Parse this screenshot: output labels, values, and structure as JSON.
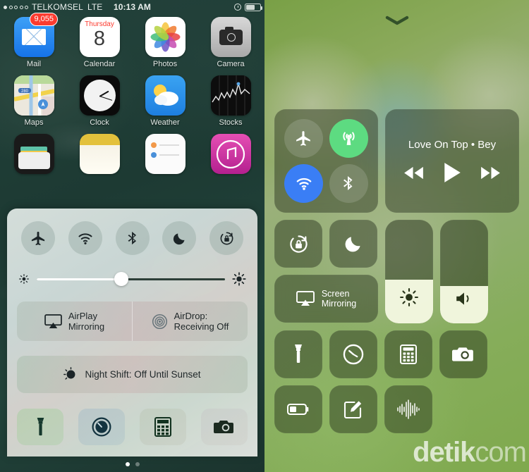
{
  "statusbar": {
    "carrier": "TELKOMSEL",
    "network": "LTE",
    "time": "10:13 AM",
    "signal_dots_total": 5,
    "signal_dots_filled": 1,
    "alarm_icon": "alarm-clock-icon",
    "battery_icon": "battery-icon",
    "battery_level_pct": 62
  },
  "homescreen": {
    "rows": [
      [
        {
          "label": "Mail",
          "icon": "mail-icon",
          "badge": "9,055"
        },
        {
          "label": "Calendar",
          "icon": "calendar-icon",
          "weekday": "Thursday",
          "day": "8"
        },
        {
          "label": "Photos",
          "icon": "photos-icon"
        },
        {
          "label": "Camera",
          "icon": "camera-icon"
        }
      ],
      [
        {
          "label": "Maps",
          "icon": "maps-icon",
          "route_badge": "280"
        },
        {
          "label": "Clock",
          "icon": "clock-icon"
        },
        {
          "label": "Weather",
          "icon": "weather-icon"
        },
        {
          "label": "Stocks",
          "icon": "stocks-icon"
        }
      ]
    ]
  },
  "control_center_ios10": {
    "toggles": [
      {
        "name": "airplane-mode",
        "icon": "airplane-icon",
        "active": false
      },
      {
        "name": "wifi",
        "icon": "wifi-icon",
        "active": false
      },
      {
        "name": "bluetooth",
        "icon": "bluetooth-icon",
        "active": false
      },
      {
        "name": "do-not-disturb",
        "icon": "moon-icon",
        "active": false
      },
      {
        "name": "rotation-lock",
        "icon": "rotation-lock-icon",
        "active": false
      }
    ],
    "brightness": {
      "low_icon": "brightness-low-icon",
      "high_icon": "brightness-high-icon",
      "value_pct": 45
    },
    "airplay": {
      "line1": "AirPlay",
      "line2": "Mirroring",
      "icon": "airplay-icon"
    },
    "airdrop": {
      "line1": "AirDrop:",
      "line2": "Receiving Off",
      "icon": "airdrop-icon"
    },
    "night_shift": {
      "label": "Night Shift: Off Until Sunset",
      "icon": "night-shift-icon"
    },
    "shortcuts": [
      {
        "name": "flashlight",
        "icon": "flashlight-icon"
      },
      {
        "name": "timer",
        "icon": "timer-icon"
      },
      {
        "name": "calculator",
        "icon": "calculator-icon"
      },
      {
        "name": "camera",
        "icon": "camera-icon"
      }
    ],
    "page_dots": {
      "count": 2,
      "active_index": 0
    }
  },
  "control_center_ios11": {
    "grabber_icon": "chevron-down-icon",
    "connectivity": [
      {
        "name": "airplane-mode",
        "icon": "airplane-icon",
        "state": "off",
        "color": "rgba(255,255,255,.14)"
      },
      {
        "name": "cellular-data",
        "icon": "cellular-antenna-icon",
        "state": "on",
        "color": "#5ddb81"
      },
      {
        "name": "wifi",
        "icon": "wifi-icon",
        "state": "on",
        "color": "#3a7ef5"
      },
      {
        "name": "bluetooth",
        "icon": "bluetooth-icon",
        "state": "off",
        "color": "rgba(255,255,255,.14)"
      }
    ],
    "music": {
      "now_playing": "Love On Top • Bey",
      "rewind_icon": "rewind-icon",
      "play_icon": "play-icon",
      "forward_icon": "fast-forward-icon"
    },
    "rotation_lock": {
      "name": "rotation-lock",
      "icon": "rotation-lock-icon"
    },
    "do_not_disturb": {
      "name": "do-not-disturb",
      "icon": "moon-icon"
    },
    "screen_mirroring": {
      "line1": "Screen",
      "line2": "Mirroring",
      "icon": "screen-mirroring-icon"
    },
    "brightness_slider": {
      "icon": "brightness-icon",
      "value_pct": 42
    },
    "volume_slider": {
      "icon": "volume-icon",
      "value_pct": 36
    },
    "shortcuts": [
      {
        "name": "flashlight",
        "icon": "flashlight-icon"
      },
      {
        "name": "timer",
        "icon": "timer-icon"
      },
      {
        "name": "calculator",
        "icon": "calculator-icon"
      },
      {
        "name": "camera",
        "icon": "camera-icon"
      },
      {
        "name": "low-power-mode",
        "icon": "battery-icon"
      },
      {
        "name": "notes",
        "icon": "notes-pencil-icon"
      },
      {
        "name": "voice-memos",
        "icon": "voice-memo-waveform-icon"
      }
    ]
  },
  "watermark": {
    "bold": "detik",
    "light": "com"
  }
}
